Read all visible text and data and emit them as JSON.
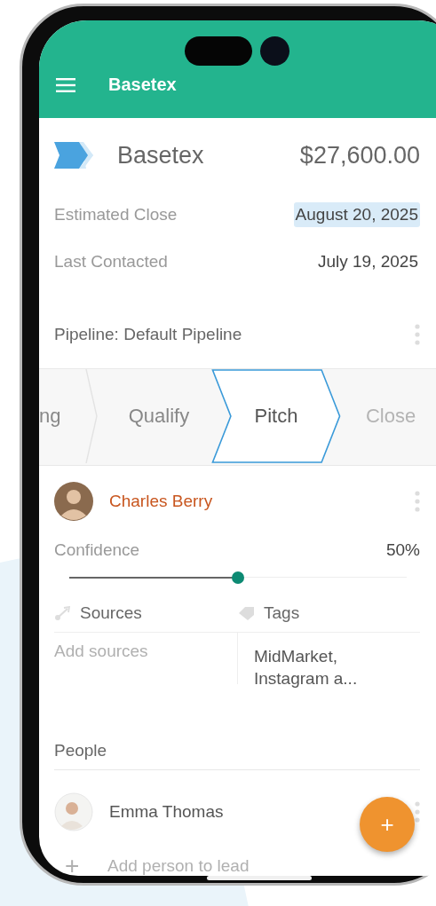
{
  "app_bar": {
    "title": "Basetex"
  },
  "lead": {
    "name": "Basetex",
    "amount": "$27,600.00"
  },
  "fields": [
    {
      "label": "Estimated Close",
      "value": "August 20, 2025",
      "selected": true
    },
    {
      "label": "Last Contacted",
      "value": "July 19, 2025",
      "selected": false
    }
  ],
  "pipeline": {
    "label": "Pipeline: Default Pipeline",
    "stages": [
      {
        "label": "ng",
        "selected": false,
        "reached": true
      },
      {
        "label": "Qualify",
        "selected": false,
        "reached": true
      },
      {
        "label": "Pitch",
        "selected": true,
        "reached": true
      },
      {
        "label": "Close",
        "selected": false,
        "reached": false
      }
    ]
  },
  "owner": {
    "name": "Charles Berry"
  },
  "confidence": {
    "label": "Confidence",
    "reading": "50%",
    "level": 0.5
  },
  "sources": {
    "label": "Sources",
    "placeholder": "Add sources"
  },
  "tags": {
    "label": "Tags",
    "value": "MidMarket, Instagram a..."
  },
  "people": {
    "heading": "People",
    "items": [
      {
        "name": "Emma Thomas"
      }
    ],
    "add_label": "Add person to lead",
    "add_icon": "+"
  },
  "fab": {
    "label": "+"
  }
}
